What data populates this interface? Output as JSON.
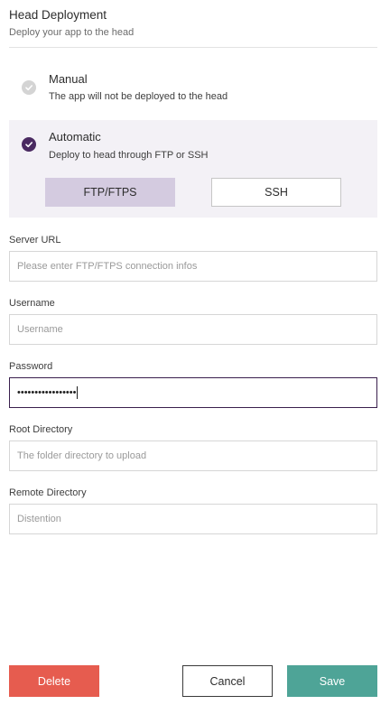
{
  "header": {
    "title": "Head Deployment",
    "subtitle": "Deploy your app to the head"
  },
  "options": {
    "manual": {
      "title": "Manual",
      "description": "The app will not be deployed to the head",
      "selected": false
    },
    "automatic": {
      "title": "Automatic",
      "description": "Deploy to head through FTP or SSH",
      "selected": true
    }
  },
  "protocols": {
    "ftp_label": "FTP/FTPS",
    "ssh_label": "SSH",
    "selected": "FTP/FTPS"
  },
  "fields": {
    "server_url": {
      "label": "Server URL",
      "value": "",
      "placeholder": "Please enter FTP/FTPS connection infos"
    },
    "username": {
      "label": "Username",
      "value": "",
      "placeholder": "Username"
    },
    "password": {
      "label": "Password",
      "value": "•••••••••••••••••",
      "placeholder": ""
    },
    "root_directory": {
      "label": "Root Directory",
      "value": "",
      "placeholder": "The folder directory to upload"
    },
    "remote_directory": {
      "label": "Remote Directory",
      "value": "",
      "placeholder": "Distention"
    }
  },
  "actions": {
    "delete_label": "Delete",
    "cancel_label": "Cancel",
    "save_label": "Save"
  },
  "colors": {
    "accent": "#4a2a61",
    "selected_tab": "#d4cbe0",
    "delete": "#e65c4f",
    "save": "#4ea497"
  }
}
